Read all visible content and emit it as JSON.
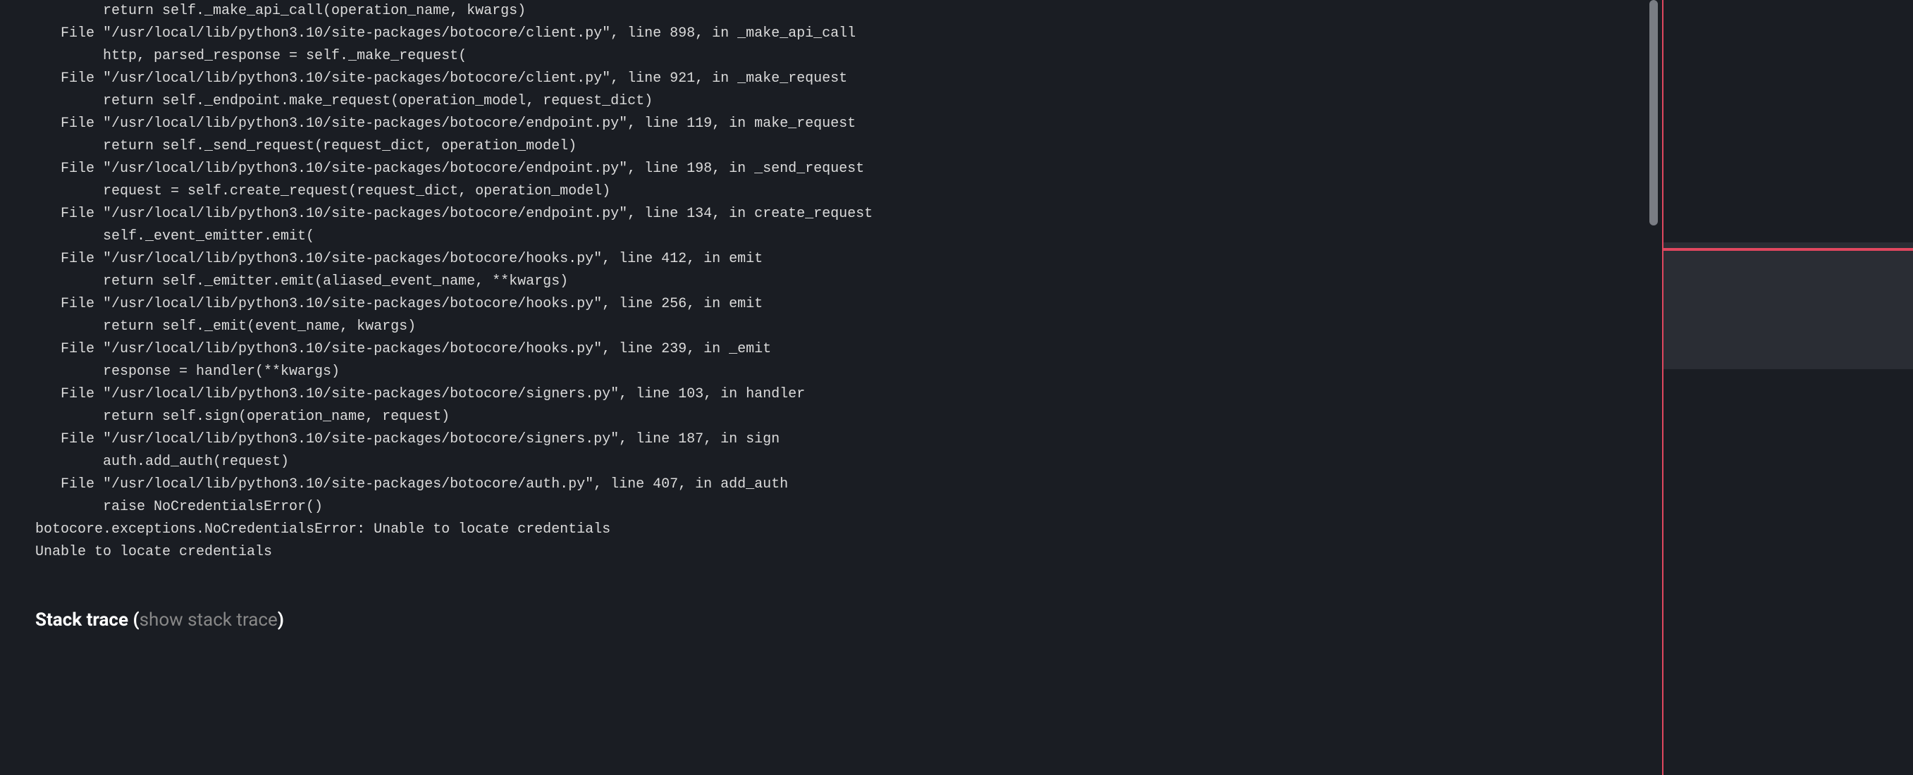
{
  "traceback": {
    "preamble_code": "  return self._make_api_call(operation_name, kwargs)",
    "frames": [
      {
        "file": "File \"/usr/local/lib/python3.10/site-packages/botocore/client.py\", line 898, in _make_api_call",
        "code": "  http, parsed_response = self._make_request("
      },
      {
        "file": "File \"/usr/local/lib/python3.10/site-packages/botocore/client.py\", line 921, in _make_request",
        "code": "  return self._endpoint.make_request(operation_model, request_dict)"
      },
      {
        "file": "File \"/usr/local/lib/python3.10/site-packages/botocore/endpoint.py\", line 119, in make_request",
        "code": "  return self._send_request(request_dict, operation_model)"
      },
      {
        "file": "File \"/usr/local/lib/python3.10/site-packages/botocore/endpoint.py\", line 198, in _send_request",
        "code": "  request = self.create_request(request_dict, operation_model)"
      },
      {
        "file": "File \"/usr/local/lib/python3.10/site-packages/botocore/endpoint.py\", line 134, in create_request",
        "code": "  self._event_emitter.emit("
      },
      {
        "file": "File \"/usr/local/lib/python3.10/site-packages/botocore/hooks.py\", line 412, in emit",
        "code": "  return self._emitter.emit(aliased_event_name, **kwargs)"
      },
      {
        "file": "File \"/usr/local/lib/python3.10/site-packages/botocore/hooks.py\", line 256, in emit",
        "code": "  return self._emit(event_name, kwargs)"
      },
      {
        "file": "File \"/usr/local/lib/python3.10/site-packages/botocore/hooks.py\", line 239, in _emit",
        "code": "  response = handler(**kwargs)"
      },
      {
        "file": "File \"/usr/local/lib/python3.10/site-packages/botocore/signers.py\", line 103, in handler",
        "code": "  return self.sign(operation_name, request)"
      },
      {
        "file": "File \"/usr/local/lib/python3.10/site-packages/botocore/signers.py\", line 187, in sign",
        "code": "  auth.add_auth(request)"
      },
      {
        "file": "File \"/usr/local/lib/python3.10/site-packages/botocore/auth.py\", line 407, in add_auth",
        "code": "  raise NoCredentialsError()"
      }
    ],
    "error_lines": [
      "botocore.exceptions.NoCredentialsError: Unable to locate credentials",
      "Unable to locate credentials"
    ]
  },
  "stack_trace_section": {
    "label_prefix": "Stack trace (",
    "link_text": "show stack trace",
    "label_suffix": ")"
  }
}
